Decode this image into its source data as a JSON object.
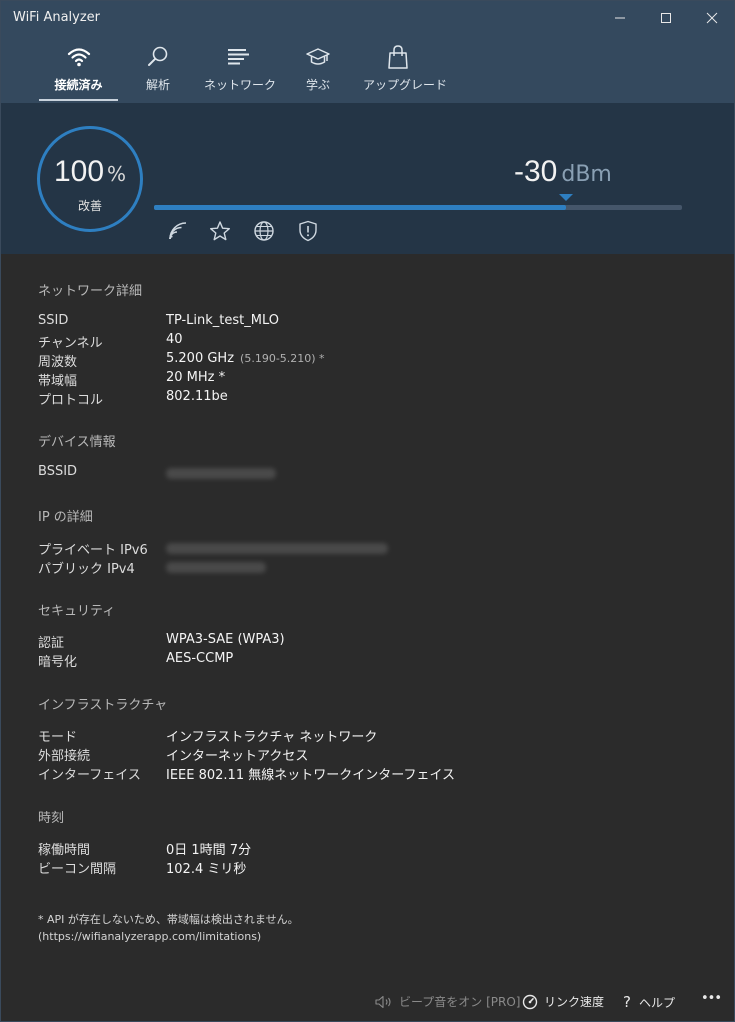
{
  "window": {
    "title": "WiFi Analyzer"
  },
  "tabs": [
    {
      "label": "接続済み",
      "icon": "wifi-icon"
    },
    {
      "label": "解析",
      "icon": "magnifier-icon"
    },
    {
      "label": "ネットワーク",
      "icon": "list-icon"
    },
    {
      "label": "学ぶ",
      "icon": "graduation-cap-icon"
    },
    {
      "label": "アップグレード",
      "icon": "shopping-bag-icon"
    }
  ],
  "signal": {
    "quality_value": "100",
    "quality_unit": "%",
    "quality_label": "改善",
    "quality_fraction": 1.0,
    "strength_value": "-30",
    "strength_unit": "dBm",
    "strength_fraction": 0.78,
    "icons": [
      "wifi-signal-icon",
      "star-icon",
      "globe-icon",
      "shield-alert-icon"
    ],
    "accent_color": "#2e7fc1"
  },
  "sections": {
    "network": {
      "title": "ネットワーク詳細",
      "rows": [
        {
          "key": "SSID",
          "value": "TP-Link_test_MLO"
        },
        {
          "key": "チャンネル",
          "value": "40"
        },
        {
          "key": "周波数",
          "value": "5.200 GHz",
          "extra": "(5.190-5.210) *"
        },
        {
          "key": "帯域幅",
          "value": "20 MHz *"
        },
        {
          "key": "プロトコル",
          "value": "802.11be"
        }
      ]
    },
    "device": {
      "title": "デバイス情報",
      "rows": [
        {
          "key": "BSSID"
        }
      ]
    },
    "ip": {
      "title": "IP の詳細",
      "rows": [
        {
          "key": "プライベート IPv6"
        },
        {
          "key": "パブリック IPv4"
        }
      ]
    },
    "security": {
      "title": "セキュリティ",
      "rows": [
        {
          "key": "認証",
          "value": "WPA3-SAE (WPA3)"
        },
        {
          "key": "暗号化",
          "value": "AES-CCMP"
        }
      ]
    },
    "infra": {
      "title": "インフラストラクチャ",
      "rows": [
        {
          "key": "モード",
          "value": "インフラストラクチャ ネットワーク"
        },
        {
          "key": "外部接続",
          "value": "インターネットアクセス"
        },
        {
          "key": "インターフェイス",
          "value": "IEEE 802.11 無線ネットワークインターフェイス"
        }
      ]
    },
    "time": {
      "title": "時刻",
      "rows": [
        {
          "key": "稼働時間",
          "value": "0日 1時間 7分"
        },
        {
          "key": "ビーコン間隔",
          "value": "102.4 ミリ秒"
        }
      ]
    }
  },
  "note": {
    "line1": "* API が存在しないため、帯域幅は検出されません。",
    "line2": "(https://wifianalyzerapp.com/limitations)"
  },
  "footer": {
    "beep_label": "ビープ音をオン [PRO]",
    "link_speed_label": "リンク速度",
    "help_label": "ヘルプ",
    "more_label": "•••"
  }
}
